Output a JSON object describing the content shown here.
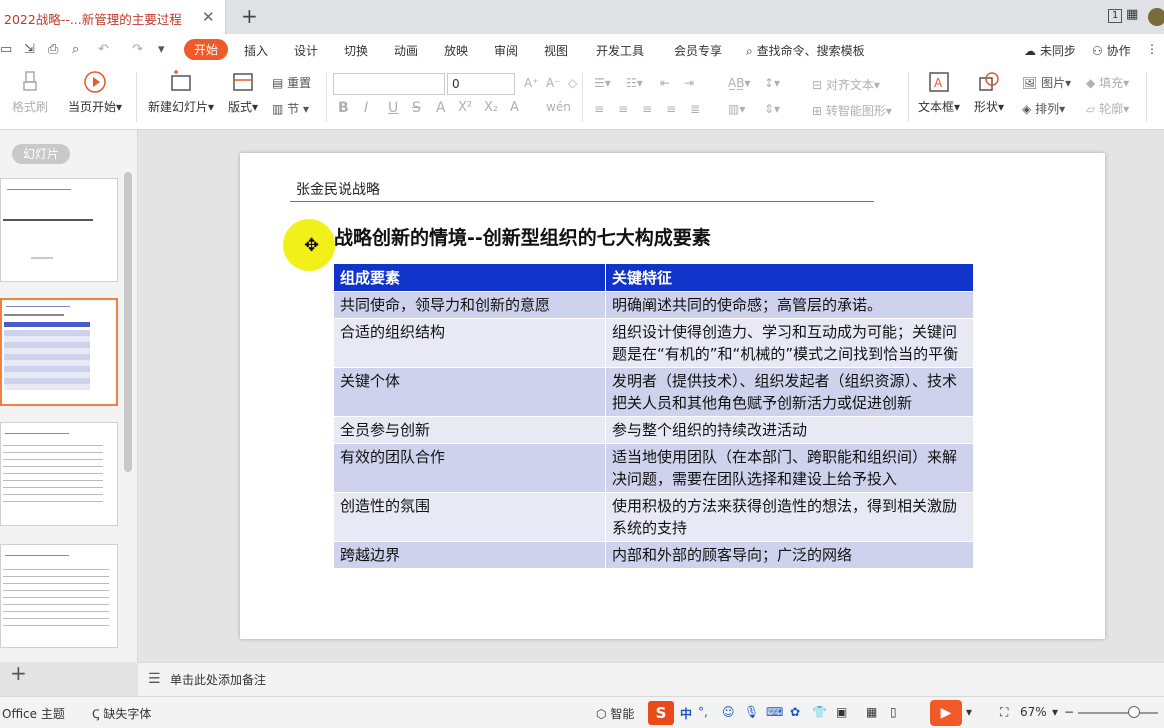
{
  "window": {
    "doc_tab_title": "2022战略--...新管理的主要过程",
    "page_indicator": "1",
    "close_glyph": "✕",
    "new_tab_glyph": "+"
  },
  "menu": {
    "items": [
      "开始",
      "插入",
      "设计",
      "切换",
      "动画",
      "放映",
      "审阅",
      "视图",
      "开发工具",
      "会员专享"
    ],
    "active_index": 0,
    "search_placeholder": "查找命令、搜索模板",
    "unsynced": "未同步",
    "collab": "协作"
  },
  "ribbon": {
    "format_painter": "格式刷",
    "play_from_current": "当页开始",
    "new_slide": "新建幻灯片",
    "layout": "版式",
    "reset": "重置",
    "section": "节",
    "font_size": "0",
    "align_text": "对齐文本",
    "convert_smartart": "转智能图形",
    "textbox": "文本框",
    "shape": "形状",
    "picture": "图片",
    "arrange": "排列",
    "fill": "填充",
    "outline": "轮廓"
  },
  "left_panel": {
    "slides_tab": "幻灯片",
    "add_slide_glyph": "+"
  },
  "slide": {
    "header": "张金民说战略",
    "title": "战略创新的情境--创新型组织的七大构成要素",
    "table": {
      "headers": [
        "组成要素",
        "关键特征"
      ],
      "rows": [
        [
          "共同使命，领导力和创新的意愿",
          "明确阐述共同的使命感；高管层的承诺。"
        ],
        [
          "合适的组织结构",
          "组织设计使得创造力、学习和互动成为可能；关键问题是在“有机的”和“机械的”模式之间找到恰当的平衡"
        ],
        [
          "关键个体",
          "发明者（提供技术）、组织发起者（组织资源）、技术把关人员和其他角色赋予创新活力或促进创新"
        ],
        [
          "全员参与创新",
          "参与整个组织的持续改进活动"
        ],
        [
          "有效的团队合作",
          "适当地使用团队（在本部门、跨职能和组织间）来解决问题，需要在团队选择和建设上给予投入"
        ],
        [
          "创造性的氛围",
          "使用积极的方法来获得创造性的想法，得到相关激励系统的支持"
        ],
        [
          "跨越边界",
          "内部和外部的顾客导向；广泛的网络"
        ]
      ]
    }
  },
  "notes": {
    "placeholder": "单击此处添加备注"
  },
  "status": {
    "theme": "Office 主题",
    "missing_font": "缺失字体",
    "smart": "智能",
    "ime_label": "S",
    "ime_mode": "中",
    "zoom": "67%"
  }
}
